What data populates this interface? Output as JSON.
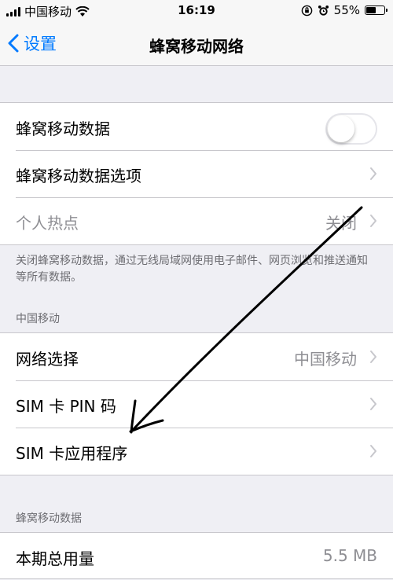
{
  "status_bar": {
    "carrier": "中国移动",
    "time": "16:19",
    "battery_text": "55%",
    "battery_level": 0.55,
    "icons": [
      "signal-icon",
      "wifi-icon",
      "orientation-lock-icon",
      "alarm-icon",
      "battery-icon"
    ]
  },
  "nav": {
    "back_label": "设置",
    "title": "蜂窝移动网络"
  },
  "group1": {
    "cellular_data": {
      "label": "蜂窝移动数据",
      "toggle_on": false
    },
    "data_options": {
      "label": "蜂窝移动数据选项"
    },
    "hotspot": {
      "label": "个人热点",
      "value": "关闭"
    }
  },
  "footer_note": "关闭蜂窝移动数据，通过无线局域网使用电子邮件、网页浏览和推送通知等所有数据。",
  "carrier_section": {
    "header": "中国移动",
    "network_selection": {
      "label": "网络选择",
      "value": "中国移动"
    },
    "sim_pin": {
      "label": "SIM 卡 PIN 码"
    },
    "sim_apps": {
      "label": "SIM 卡应用程序"
    }
  },
  "usage_section": {
    "header": "蜂窝移动数据",
    "current_period": {
      "label": "本期总用量",
      "value": "5.5 MB"
    }
  },
  "colors": {
    "accent": "#007aff",
    "background": "#efeff4",
    "secondary_text": "#8e8e93",
    "annotation": "#000000"
  }
}
